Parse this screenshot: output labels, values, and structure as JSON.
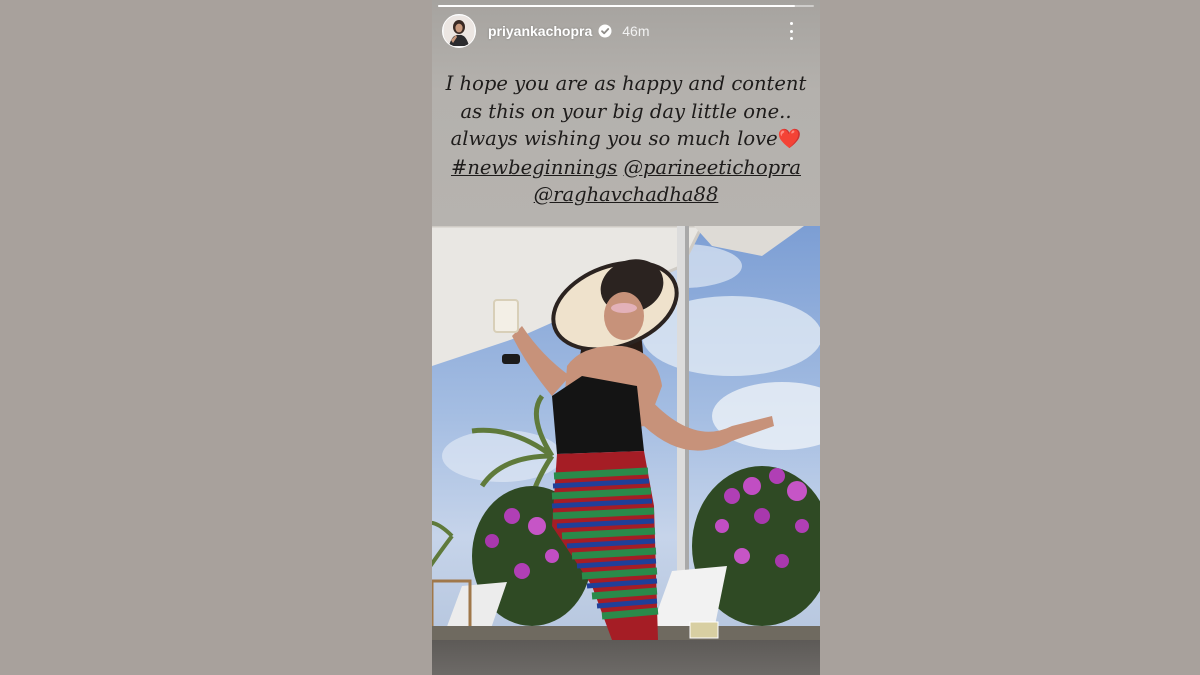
{
  "story": {
    "progress": 0.95,
    "username": "priyankachopra",
    "time_ago": "46m",
    "caption": {
      "line1": "I hope you are as happy and content",
      "line2": "as this on your big day little one..",
      "line3": "always wishing you so much love",
      "hashtag": "#newbeginnings",
      "mention1": "@parineetichopra",
      "mention2": "@raghavchadha88"
    }
  },
  "icons": {
    "verified": "verified-badge-icon",
    "more": "more-options-icon",
    "heart": "red-heart-emoji"
  },
  "colors": {
    "page_background": "#a8a19c",
    "text_panel": "#b4b1ad",
    "caption_text": "#1e1c1b",
    "verified_blue": "#ffffff",
    "heart_red": "#e0242c"
  }
}
